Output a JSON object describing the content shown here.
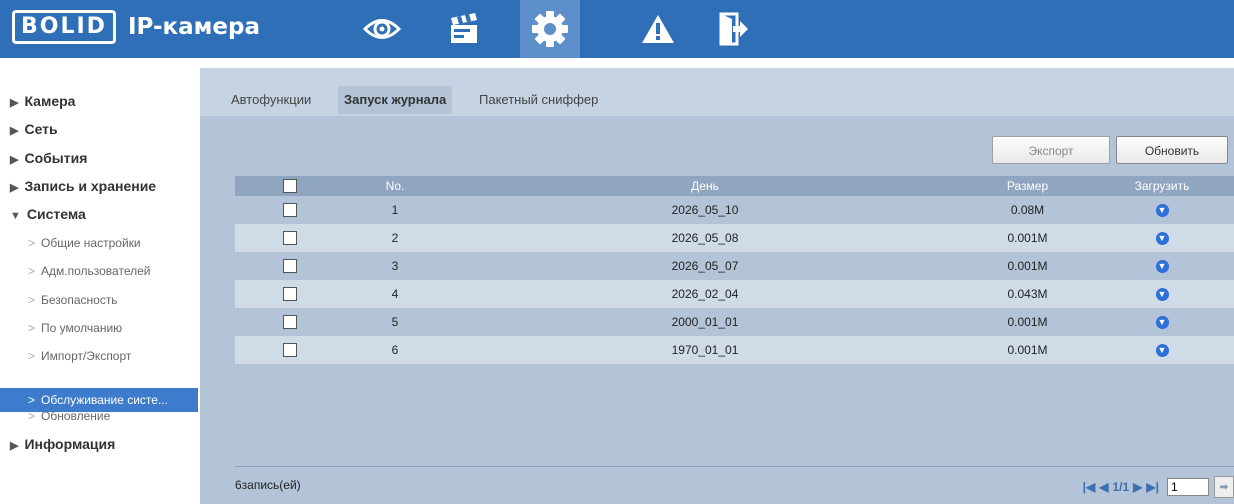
{
  "header": {
    "logo_mark": "BOLID",
    "title": "IP-камера",
    "icons": [
      "eye-icon",
      "clapperboard-icon",
      "gear-icon",
      "warning-icon",
      "exit-icon"
    ],
    "active_icon": "gear-icon"
  },
  "sidebar": {
    "categories": {
      "camera": "Камера",
      "network": "Сеть",
      "events": "События",
      "storage": "Запись и хранение",
      "system": "Система",
      "info": "Информация"
    },
    "system_items": [
      "Общие настройки",
      "Адм.пользователей",
      "Безопасность",
      "По умолчанию",
      "Импорт/Экспорт",
      "Обслуживание систе...",
      "Обновление"
    ],
    "active_item": "Обслуживание систе..."
  },
  "tabs": [
    "Автофункции",
    "Запуск журнала",
    "Пакетный сниффер"
  ],
  "active_tab": "Запуск журнала",
  "toolbar": {
    "export_label": "Экспорт",
    "refresh_label": "Обновить"
  },
  "table": {
    "headers": {
      "no": "No.",
      "day": "День",
      "size": "Размер",
      "download": "Загрузить"
    },
    "rows": [
      {
        "no": "1",
        "day": "2026_05_10",
        "size": "0.08M"
      },
      {
        "no": "2",
        "day": "2026_05_08",
        "size": "0.001M"
      },
      {
        "no": "3",
        "day": "2026_05_07",
        "size": "0.001M"
      },
      {
        "no": "4",
        "day": "2026_02_04",
        "size": "0.043M"
      },
      {
        "no": "5",
        "day": "2000_01_01",
        "size": "0.001M"
      },
      {
        "no": "6",
        "day": "1970_01_01",
        "size": "0.001M"
      }
    ]
  },
  "footer": {
    "records": "6запись(ей)",
    "page_info": "1/1",
    "page_input": "1"
  },
  "colors": {
    "header_bg": "#2f6fb7",
    "active_icon_bg": "#5d8fcb",
    "content_bg": "#b3c4d8",
    "table_header_bg": "#90a6c0",
    "sidebar_active": "#3d7ccc",
    "download_icon": "#2d6fd6"
  }
}
